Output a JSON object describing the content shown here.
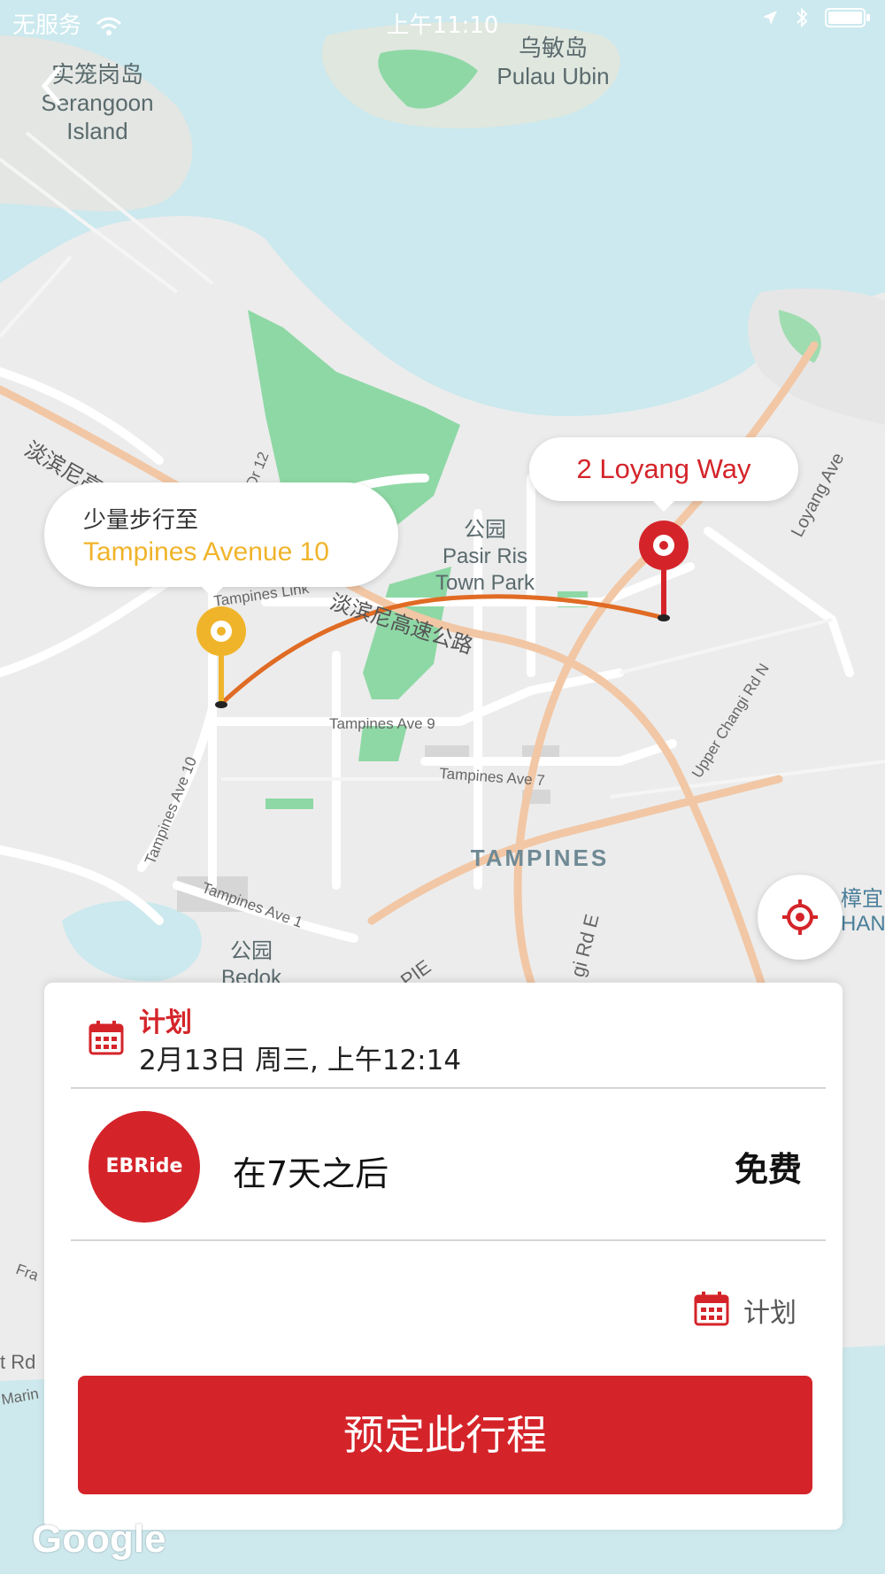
{
  "status_bar": {
    "carrier": "无服务",
    "time": "上午11:10"
  },
  "map_labels": {
    "serangoon": "实笼岗岛",
    "serangoon_en1": "Serangoon",
    "serangoon_en2": "Island",
    "ubin": "乌敏岛",
    "ubin_en": "Pulau Ubin",
    "park": "公园",
    "park_en1": "Pasir Ris",
    "park_en2": "Town Park",
    "tampines": "TAMPINES",
    "park2": "公园",
    "park2_en": "Bedok",
    "changi": "樟宜",
    "changi_en": "HAN"
  },
  "road_labels": {
    "expressway": "淡滨尼高速公路",
    "expressway2": "淡滨尼高",
    "loyang_ave": "Loyang Ave",
    "tampines_link": "Tampines Link",
    "tampines_ave9": "Tampines Ave 9",
    "tampines_ave7": "Tampines Ave 7",
    "tampines_ave10": "Tampines Ave 10",
    "tampines_ave1": "Tampines Ave 1",
    "upper_changi": "Upper Changi Rd N",
    "pie": "PIE",
    "changi_rd_e": "gi Rd E",
    "pasir_dr": "is Dr 12",
    "t_rd": "t Rd",
    "fra": "Fra",
    "marine": "Marin"
  },
  "pickup": {
    "hint": "少量步行至",
    "name": "Tampines Avenue 10"
  },
  "destination": {
    "name": "2 Loyang Way"
  },
  "panel": {
    "schedule_title": "计划",
    "schedule_datetime": "2月13日 周三, 上午12:14",
    "provider_logo": "EBRide",
    "availability": "在7天之后",
    "price": "免费",
    "plan_label": "计划",
    "book_label": "预定此行程"
  },
  "watermark": "Google",
  "colors": {
    "accent": "#d4242a",
    "pickup": "#f0b42b",
    "park_green": "#8ed8a5",
    "water": "#cbe9ee"
  }
}
